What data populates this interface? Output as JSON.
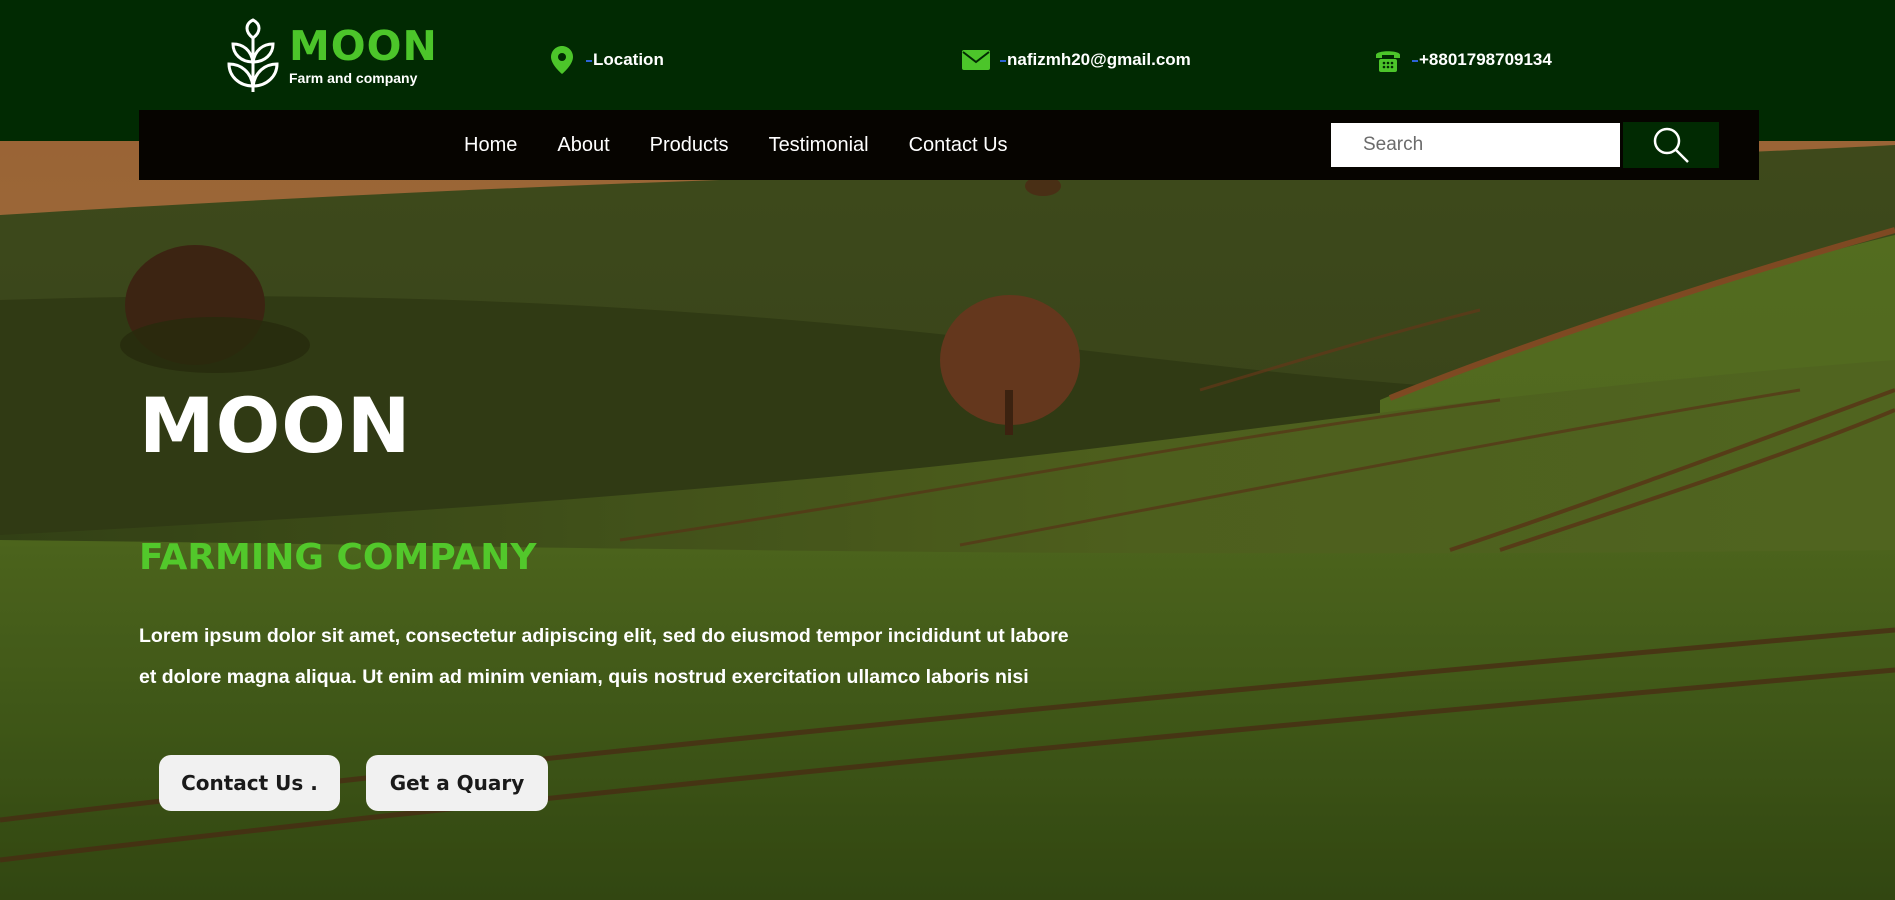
{
  "brand": {
    "name": "MOON",
    "tagline": "Farm and company",
    "accent_color": "#4cc52a",
    "topbar_color": "#012a02"
  },
  "contact": {
    "location": {
      "icon": "map-pin-icon",
      "text": "Location"
    },
    "email": {
      "icon": "envelope-icon",
      "text": "nafizmh20@gmail.com"
    },
    "phone": {
      "icon": "telephone-icon",
      "text": "+8801798709134"
    }
  },
  "nav": {
    "items": [
      {
        "label": "Home"
      },
      {
        "label": "About"
      },
      {
        "label": "Products"
      },
      {
        "label": "Testimonial"
      },
      {
        "label": "Contact Us"
      }
    ]
  },
  "search": {
    "placeholder": "Search",
    "button_icon": "search-icon"
  },
  "hero": {
    "title": "MOON",
    "subtitle": "FARMING COMPANY",
    "description_line1": "Lorem ipsum dolor sit amet, consectetur adipiscing elit, sed do eiusmod tempor incididunt ut labore",
    "description_line2": "et dolore magna aliqua. Ut enim ad minim veniam, quis nostrud exercitation ullamco laboris nisi",
    "primary_button": "Contact Us .",
    "secondary_button": "Get a Quary"
  }
}
